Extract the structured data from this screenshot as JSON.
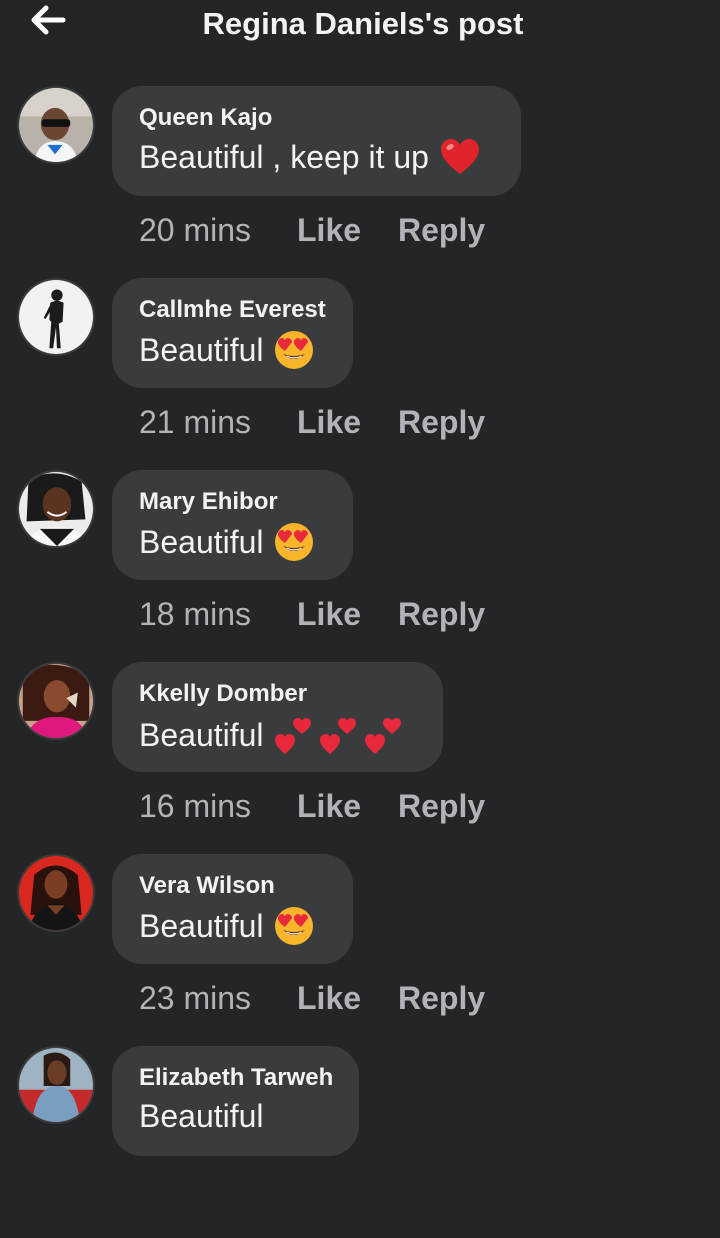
{
  "header": {
    "title": "Regina Daniels's post",
    "back_icon": "back-arrow-icon"
  },
  "comments": [
    {
      "author": "Queen Kajo",
      "text": "Beautiful , keep it up",
      "emoji": "red-heart-icon",
      "time": "20 mins",
      "like": "Like",
      "reply": "Reply"
    },
    {
      "author": "Callmhe Everest",
      "text": "Beautiful",
      "emoji": "heart-eyes-icon",
      "time": "21 mins",
      "like": "Like",
      "reply": "Reply"
    },
    {
      "author": "Mary Ehibor",
      "text": "Beautiful",
      "emoji": "heart-eyes-icon",
      "time": "18 mins",
      "like": "Like",
      "reply": "Reply"
    },
    {
      "author": "Kkelly Domber",
      "text": "Beautiful",
      "emoji": "two-hearts-icon",
      "time": "16 mins",
      "like": "Like",
      "reply": "Reply"
    },
    {
      "author": "Vera Wilson",
      "text": "Beautiful",
      "emoji": "heart-eyes-icon",
      "time": "23 mins",
      "like": "Like",
      "reply": "Reply"
    },
    {
      "author": "Elizabeth Tarweh",
      "text": "Beautiful"
    }
  ]
}
